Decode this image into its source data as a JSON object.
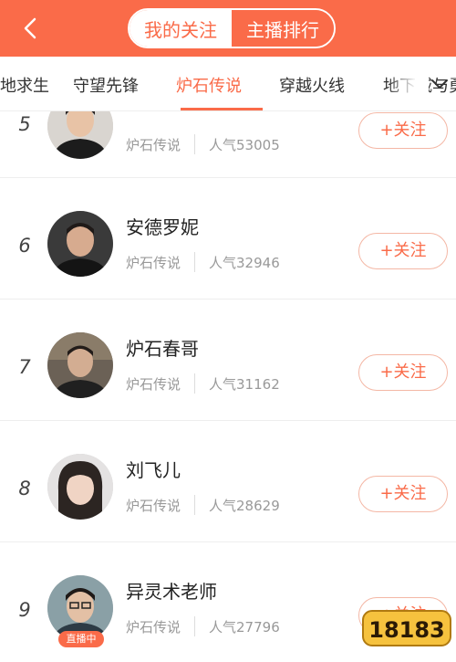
{
  "header": {
    "back_icon": "chevron-left-icon",
    "segments": [
      {
        "label": "我的关注",
        "active": false
      },
      {
        "label": "主播排行",
        "active": true
      }
    ],
    "accent_color": "#fa6b49"
  },
  "tabs": {
    "items": [
      {
        "label": "绝地求生",
        "active": false
      },
      {
        "label": "守望先锋",
        "active": false
      },
      {
        "label": "炉石传说",
        "active": true
      },
      {
        "label": "穿越火线",
        "active": false
      },
      {
        "label": "地下城与勇士",
        "active": false
      }
    ],
    "more_icon": "chevron-down-icon"
  },
  "ranking": [
    {
      "rank": "5",
      "name": "",
      "game": "炉石传说",
      "popularity": "人气53005",
      "follow_label": "+关注",
      "live": false
    },
    {
      "rank": "6",
      "name": "安德罗妮",
      "game": "炉石传说",
      "popularity": "人气32946",
      "follow_label": "+关注",
      "live": false
    },
    {
      "rank": "7",
      "name": "炉石春哥",
      "game": "炉石传说",
      "popularity": "人气31162",
      "follow_label": "+关注",
      "live": false
    },
    {
      "rank": "8",
      "name": "刘飞儿",
      "game": "炉石传说",
      "popularity": "人气28629",
      "follow_label": "+关注",
      "live": false
    },
    {
      "rank": "9",
      "name": "异灵术老师",
      "game": "炉石传说",
      "popularity": "人气27796",
      "follow_label": "+关注",
      "live": true,
      "live_label": "直播中"
    }
  ],
  "watermark": {
    "text": "18183"
  }
}
